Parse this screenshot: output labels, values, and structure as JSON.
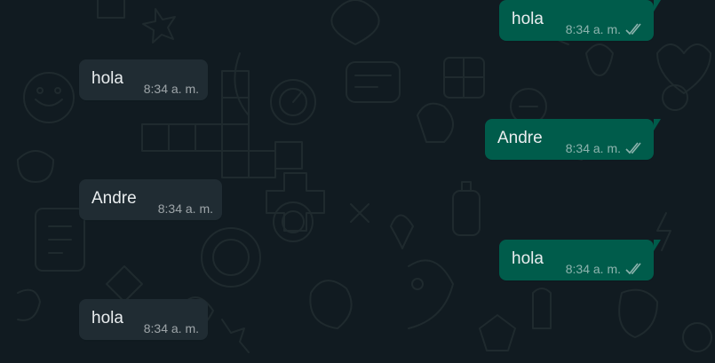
{
  "colors": {
    "background": "#111b21",
    "incoming_bubble": "#202c33",
    "outgoing_bubble": "#005c4b",
    "text": "#e9edef",
    "meta": "#8696a0"
  },
  "messages": [
    {
      "direction": "out",
      "text": "hola",
      "time": "8:34 a. m.",
      "status": "double-check-icon"
    },
    {
      "direction": "in",
      "text": "hola",
      "time": "8:34 a. m."
    },
    {
      "direction": "out",
      "text": "Andre",
      "time": "8:34 a. m.",
      "status": "double-check-icon"
    },
    {
      "direction": "in",
      "text": "Andre",
      "time": "8:34 a. m."
    },
    {
      "direction": "out",
      "text": "hola",
      "time": "8:34 a. m.",
      "status": "double-check-icon"
    },
    {
      "direction": "in",
      "text": "hola",
      "time": "8:34 a. m."
    }
  ]
}
